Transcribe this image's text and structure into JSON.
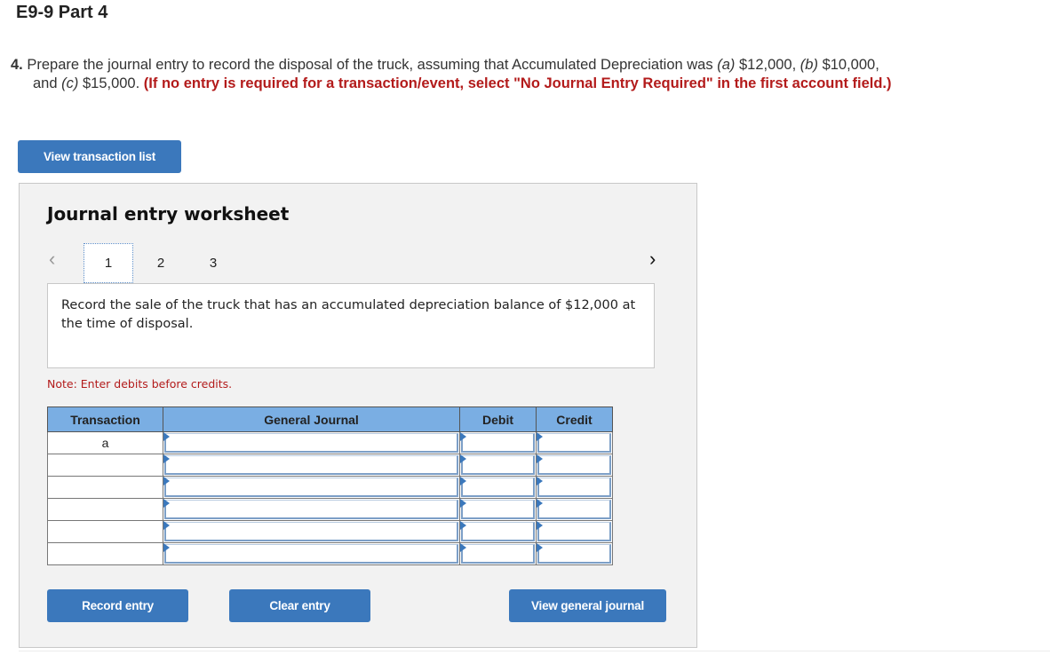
{
  "header": {
    "title": "E9-9 Part 4"
  },
  "question": {
    "number": "4.",
    "text_1": "Prepare the journal entry to record the disposal of the truck, assuming that Accumulated Depreciation was",
    "label_a": "(a)",
    "value_a": "$12,000,",
    "label_b": "(b)",
    "value_b": "$10,000,",
    "text_and": "and",
    "label_c": "(c)",
    "value_c": "$15,000.",
    "instruction": "(If no entry is required for a transaction/event, select \"No Journal Entry Required\" in the first account field.)"
  },
  "buttons": {
    "view_transaction_list": "View transaction list",
    "record_entry": "Record entry",
    "clear_entry": "Clear entry",
    "view_general_journal": "View general journal"
  },
  "worksheet": {
    "title": "Journal entry worksheet",
    "prev_icon": "‹",
    "next_icon": "›",
    "tabs": [
      "1",
      "2",
      "3"
    ],
    "active_tab": "1",
    "description": "Record the sale of the truck that has an accumulated depreciation balance of $12,000 at the time of disposal.",
    "note": "Note: Enter debits before credits.",
    "columns": [
      "Transaction",
      "General Journal",
      "Debit",
      "Credit"
    ],
    "rows": [
      {
        "transaction": "a",
        "account": "",
        "debit": "",
        "credit": ""
      },
      {
        "transaction": "",
        "account": "",
        "debit": "",
        "credit": ""
      },
      {
        "transaction": "",
        "account": "",
        "debit": "",
        "credit": ""
      },
      {
        "transaction": "",
        "account": "",
        "debit": "",
        "credit": ""
      },
      {
        "transaction": "",
        "account": "",
        "debit": "",
        "credit": ""
      },
      {
        "transaction": "",
        "account": "",
        "debit": "",
        "credit": ""
      }
    ]
  },
  "colors": {
    "button_blue": "#3b78bc",
    "header_blue": "#7aaee3",
    "instruction_red": "#b31b1b"
  }
}
